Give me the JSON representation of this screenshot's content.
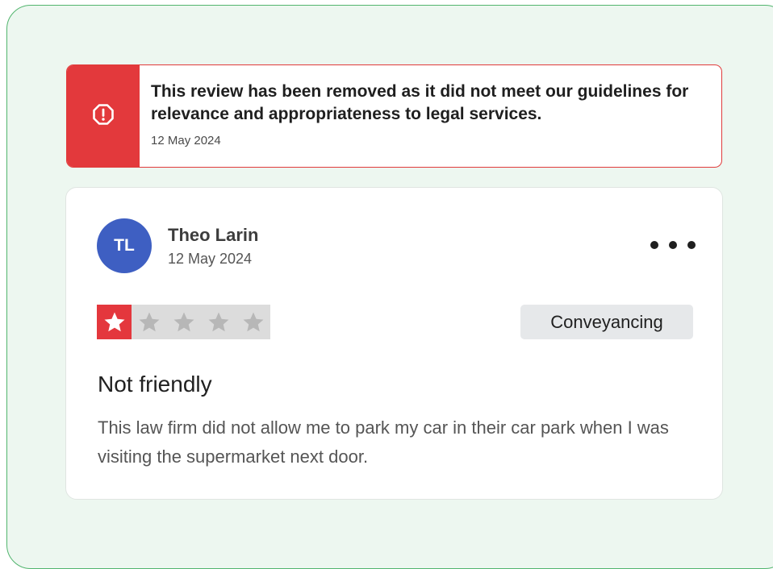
{
  "notice": {
    "icon": "alert-octagon-icon",
    "message": "This review has been removed as it did not meet our guidelines for relevance and appropriateness to legal services.",
    "date": "12 May 2024",
    "accent_color": "#e3393c"
  },
  "review": {
    "avatar_initials": "TL",
    "avatar_color": "#3e5fc2",
    "reviewer_name": "Theo Larin",
    "date": "12 May 2024",
    "rating": 1,
    "rating_max": 5,
    "category_tag": "Conveyancing",
    "title": "Not friendly",
    "body": "This law firm did not allow me to park my car in their car park when I was visiting the supermarket next door."
  }
}
